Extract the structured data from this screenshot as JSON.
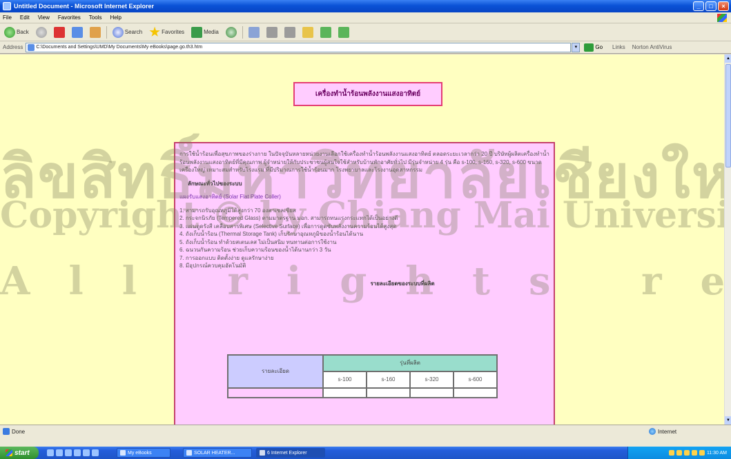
{
  "window": {
    "title": "Untitled Document - Microsoft Internet Explorer",
    "minimize": "_",
    "maximize": "□",
    "close": "×"
  },
  "menu": [
    "File",
    "Edit",
    "View",
    "Favorites",
    "Tools",
    "Help"
  ],
  "toolbar": {
    "back": "Back",
    "search": "Search",
    "favorites": "Favorites",
    "media": "Media"
  },
  "address": {
    "label": "Address",
    "value": "C:\\Documents and Settings\\UMD\\My Documents\\My eBooks\\page.go.th3.htm",
    "go": "Go",
    "links": "Links",
    "norton": "Norton AntiVirus"
  },
  "page": {
    "title": "เครื่องทำน้ำร้อนพลังงานแสงอาทิตย์",
    "intro": "การใช้น้ำร้อนเพื่อสุขภาพของร่างกาย ในปัจจุบันหลายหน่วยงานเลือกใช้เครื่องทำน้ำร้อนพลังงานแสงอาทิตย์ ตลอดระยะเวลากว่า 20 ปี บริษัทผู้ผลิตเครื่องทำน้ำร้อนพลังงานแสงอาทิตย์ที่มีคุณภาพ ผู้จำหน่ายให้กับประชาชนผู้สนใจใช้สำหรับบ้านพักอาศัยทั่วไป มีรุ่นจำหน่าย 4 รุ่น คือ s-100, s-160, s-320, s-600 ขนาดเครื่องใหญ่ เหมาะสมสำหรับโรงแรม ที่มีปริมาณการใช้น้ำร้อนมาก โรงพยาบาลและโรงงานอุตสาหกรรม",
    "section_head": "ลักษณะทั่วไปของระบบ",
    "sub_head": "แผงรับแสงอาทิตย์ (Solar Flat Plate Coller)",
    "items": [
      "1. สามารถรับอุณหภูมิได้สูงกว่า 70 องศาเซลเซียส",
      "2. กระจกนิรภัย (Tempered Glass) ตามมาตรฐาน มอก. สามารถทนแรงกระแทกได้เป็นอย่างดี",
      "3. แผ่นดูดรังสี เคลือบสารพิเศษ (Selective Surface) เพื่อการดูดซับพลังงานความร้อนได้สูงสุด",
      "4. ถังเก็บน้ำร้อน (Thermal Storage Tank) เก็บรักษาอุณหภูมิของน้ำร้อนได้นาน",
      "5. ถังเก็บน้ำร้อน ทำด้วยสเตนเลส ไม่เป็นสนิม ทนทานต่อการใช้งาน",
      "6. ฉนวนกันความร้อน ช่วยเก็บความร้อนของน้ำได้นานกว่า 3 วัน",
      "7. การออกแบบ ติดตั้งง่าย ดูแลรักษาง่าย",
      "8. มีอุปกรณ์ควบคุมอัตโนมัติ"
    ],
    "table_title": "รายละเอียดของระบบที่ผลิต"
  },
  "spec_table": {
    "row_header": "รายละเอียด",
    "group_header": "รุ่นที่ผลิต",
    "models": [
      "s-100",
      "s-160",
      "s-320",
      "s-600"
    ]
  },
  "watermark": {
    "line1": "ลิขสิทธิ์มหาวิทยาลัยเชียงใหม่",
    "line2": "Copyright © by Chiang Mai University",
    "line3": "All rights reserved"
  },
  "status": {
    "left": "Done",
    "zone": "Internet"
  },
  "taskbar": {
    "start": "start",
    "tasks": [
      "My eBooks",
      "SOLAR HEATER...",
      "6 Internet Explorer"
    ],
    "clock": "11:30 AM"
  },
  "colors": {
    "page_background": "#ffffc1",
    "content_background": "#ffccff",
    "title_border": "#e43d74",
    "table_model_header": "#99ddcc",
    "table_row_header": "#ccccff"
  }
}
